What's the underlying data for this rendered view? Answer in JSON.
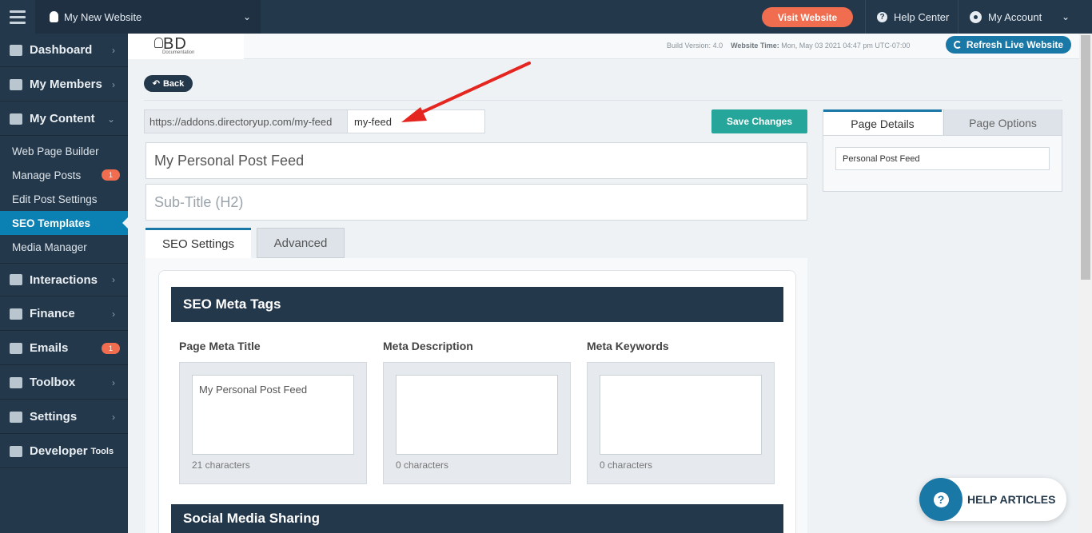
{
  "topbar": {
    "site_name": "My New Website",
    "visit_label": "Visit Website",
    "help_label": "Help Center",
    "account_label": "My Account"
  },
  "sidebar": {
    "items": [
      {
        "label": "Dashboard",
        "icon": "home-icon"
      },
      {
        "label": "My Members",
        "icon": "users-icon"
      },
      {
        "label": "My Content",
        "icon": "folder-icon"
      },
      {
        "label": "Interactions",
        "icon": "chat-icon"
      },
      {
        "label": "Finance",
        "icon": "pie-chart-icon"
      },
      {
        "label": "Emails",
        "icon": "inbox-icon",
        "badge": "1"
      },
      {
        "label": "Toolbox",
        "icon": "wrench-icon"
      },
      {
        "label": "Settings",
        "icon": "gear-icon"
      },
      {
        "label": "Developer",
        "suffix": "Tools",
        "icon": "sliders-icon"
      }
    ],
    "content_sub": [
      {
        "label": "Web Page Builder"
      },
      {
        "label": "Manage Posts",
        "badge": "1"
      },
      {
        "label": "Edit Post Settings"
      },
      {
        "label": "SEO Templates",
        "active": true
      },
      {
        "label": "Media Manager"
      }
    ]
  },
  "header": {
    "logo_text": "BD",
    "logo_sub": "Documentation",
    "build_label": "Build Version:",
    "build_value": "4.0",
    "time_label": "Website Time:",
    "time_value": "Mon, May 03 2021 04:47 pm UTC-07:00",
    "refresh_label": "Refresh Live Website"
  },
  "page": {
    "back_label": "Back",
    "url_prefix": "https://addons.directoryup.com/my-feed",
    "url_slug": "my-feed",
    "save_label": "Save Changes",
    "title_value": "My Personal Post Feed",
    "subtitle_placeholder": "Sub-Title (H2)",
    "tabs": [
      "SEO Settings",
      "Advanced"
    ],
    "seo_section_title": "SEO Meta Tags",
    "meta_fields": [
      {
        "label": "Page Meta Title",
        "value": "My Personal Post Feed",
        "count": "21 characters"
      },
      {
        "label": "Meta Description",
        "value": "",
        "count": "0 characters"
      },
      {
        "label": "Meta Keywords",
        "value": "",
        "count": "0 characters"
      }
    ],
    "social_section_title": "Social Media Sharing"
  },
  "right_panel": {
    "tabs": [
      "Page Details",
      "Page Options"
    ],
    "page_name": "Personal Post Feed"
  },
  "help_widget": {
    "label": "HELP ARTICLES"
  },
  "colors": {
    "navy": "#24384b",
    "accent_blue": "#1a78a6",
    "orange": "#f06d4f",
    "teal": "#26a69a",
    "annotation_red": "#e52620"
  }
}
